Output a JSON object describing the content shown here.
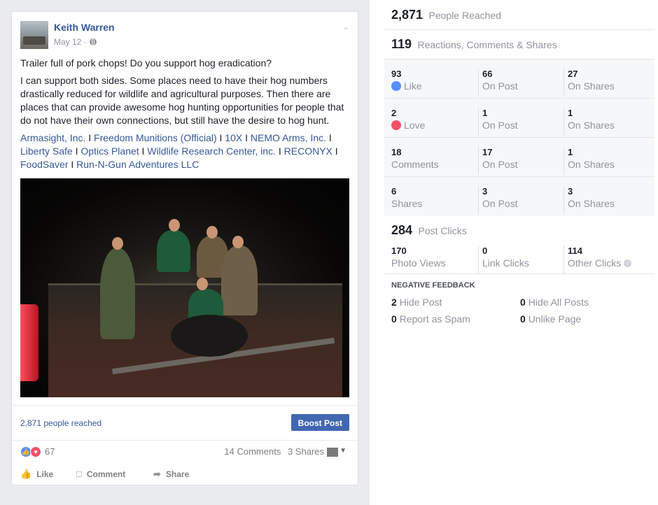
{
  "post": {
    "author": "Keith Warren",
    "date": "May 12 ·",
    "text_line1": "Trailer full of pork chops! Do you support hog eradication?",
    "text_body": "I can support both sides. Some places need to have their hog numbers drastically reduced for wildlife and agricultural purposes. Then there are places that can provide awesome hog hunting opportunities for people that do not have their own connections, but still have the desire to hog hunt.",
    "tags": [
      "Armasight, Inc.",
      "Freedom Munitions (Official)",
      "10X",
      "NEMO Arms, Inc.",
      "Liberty Safe",
      "Optics Planet",
      "Wildlife Research Center, inc.",
      "RECONYX",
      "FoodSaver",
      "Run-N-Gun Adventures LLC"
    ],
    "tag_separator": "I",
    "reach_text": "2,871 people reached",
    "boost_label": "Boost Post",
    "reaction_count": "67",
    "comments": "14 Comments",
    "shares": "3 Shares",
    "actions": {
      "like": "Like",
      "comment": "Comment",
      "share": "Share"
    }
  },
  "insights": {
    "people_reached": {
      "value": "2,871",
      "label": "People Reached"
    },
    "engagement": {
      "value": "119",
      "label": "Reactions, Comments & Shares"
    },
    "rows": [
      {
        "total": "93",
        "total_label": "Like",
        "on_post": "66",
        "on_post_label": "On Post",
        "on_shares": "27",
        "on_shares_label": "On Shares"
      },
      {
        "total": "2",
        "total_label": "Love",
        "on_post": "1",
        "on_post_label": "On Post",
        "on_shares": "1",
        "on_shares_label": "On Shares"
      },
      {
        "total": "18",
        "total_label": "Comments",
        "on_post": "17",
        "on_post_label": "On Post",
        "on_shares": "1",
        "on_shares_label": "On Shares"
      },
      {
        "total": "6",
        "total_label": "Shares",
        "on_post": "3",
        "on_post_label": "On Post",
        "on_shares": "3",
        "on_shares_label": "On Shares"
      }
    ],
    "post_clicks": {
      "value": "284",
      "label": "Post Clicks"
    },
    "clicks": [
      {
        "value": "170",
        "label": "Photo Views"
      },
      {
        "value": "0",
        "label": "Link Clicks"
      },
      {
        "value": "114",
        "label": "Other Clicks"
      }
    ],
    "negative_title": "NEGATIVE FEEDBACK",
    "negative": [
      {
        "value": "2",
        "label": "Hide Post"
      },
      {
        "value": "0",
        "label": "Hide All Posts"
      },
      {
        "value": "0",
        "label": "Report as Spam"
      },
      {
        "value": "0",
        "label": "Unlike Page"
      }
    ]
  },
  "colors": {
    "link": "#365899",
    "boost": "#4267b2",
    "like": "#5890ff",
    "love": "#f25268"
  }
}
